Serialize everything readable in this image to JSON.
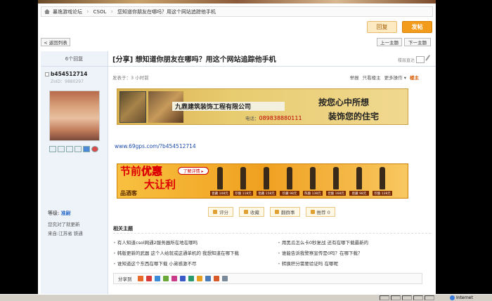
{
  "breadcrumb": {
    "items": [
      "暴逸游戏论坛",
      "CSOL",
      "您知道你朋友在哪吗？用这个网站追踪他手机"
    ]
  },
  "top_buttons": {
    "reply": "回复",
    "post": "发帖"
  },
  "nav_buttons": {
    "back": "< 返回列表",
    "prev": "上一主题",
    "next": "下一主题"
  },
  "sidebar": {
    "reply_count": "6个回复",
    "username": "b454512714",
    "uid": "ZoID：9880297",
    "level_label": "等级:",
    "level_value": "准尉",
    "friend_note": "您究对了就更新",
    "from_note": "来自:江苏省 铁通"
  },
  "post": {
    "title": "[分享] 想知道你朋友在哪吗？用这个网站追踪他手机",
    "jump_label": "楼层直达",
    "meta": "发表于：3 小时前",
    "tools": {
      "print": "举报",
      "author_only": "只看楼主",
      "more": "更多操作 ▾",
      "floor": "楼主"
    },
    "link_text": "www.69gps.com/?b454512714"
  },
  "ad_decoration": {
    "company": "九鼎建筑装饰工程有限公司",
    "phone_label": "电话：",
    "phone": "089838880111",
    "slogan1": "按您心中所想",
    "slogan2": "装饰您的住宅"
  },
  "ad_wine": {
    "big1": "节前",
    "big1b": "优惠",
    "big2": "大让利",
    "small": "品酒客",
    "pill": "了解详情 ▸",
    "bottles": [
      "窖藏 108元",
      "珍酿 118元",
      "窖藏 158元",
      "珍藏 98元",
      "陈酿 138元",
      "佳酿 168元",
      "窖藏 98元",
      "珍酿 128元"
    ]
  },
  "actions": {
    "rate": "评分",
    "collect": "收藏",
    "share": "翻群事",
    "recommend": "推荐 0"
  },
  "related": {
    "title": "相关主题",
    "items": [
      "有人知道csol网通2服务器所在地在哪吗",
      "用黑瓜怎么卡0秒复战 还有在哪下载最新的",
      "韩版更新的武器 这个人给就或这通单机的 我想知道在哪下载",
      "谁能告诉我警察宣传是0吗？在哪下载？",
      "谁知道这个东西在哪下载 小弟感激不尽",
      "转换积分需要验证吗 在哪呢"
    ]
  },
  "share_bar": {
    "label": "分享到"
  },
  "statusbar": {
    "zone": "Internet"
  }
}
